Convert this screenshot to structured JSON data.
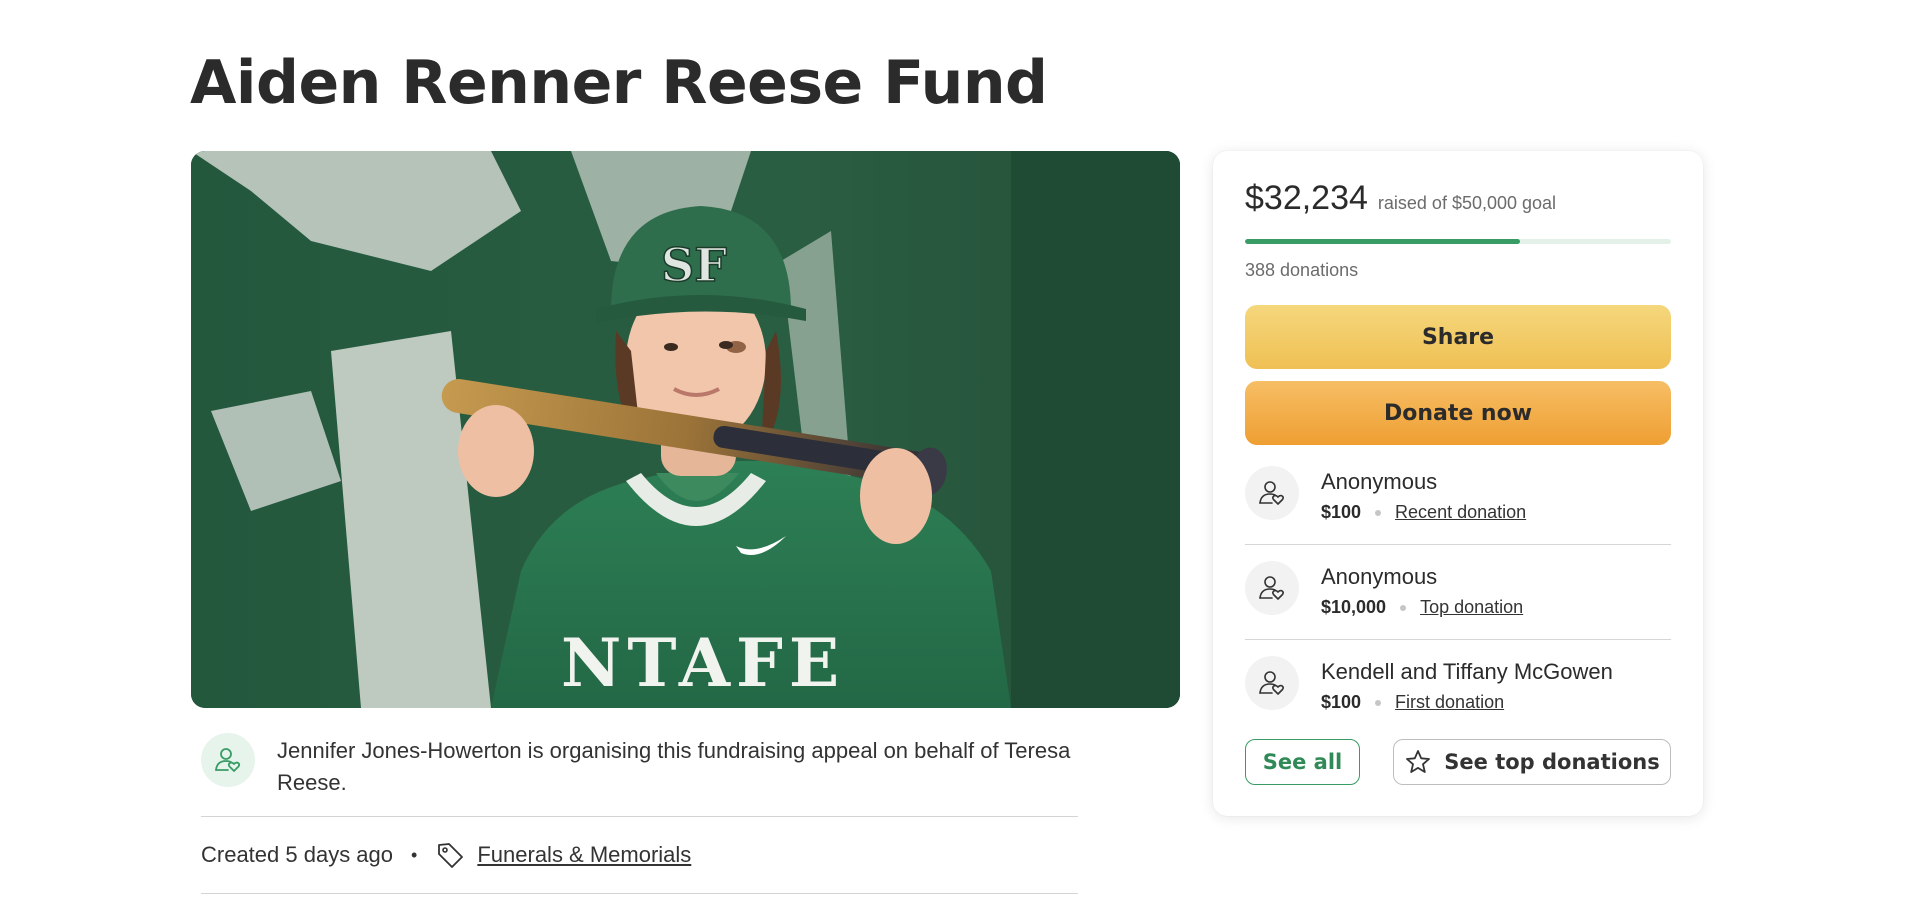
{
  "page": {
    "title": "Aiden Renner Reese Fund"
  },
  "hero_image": {
    "jersey_text": "NTAFE",
    "cap_logo": "SF"
  },
  "organiser": {
    "icon": "user-heart-icon",
    "text": "Jennifer Jones-Howerton is organising this fundraising appeal on behalf of Teresa Reese."
  },
  "meta": {
    "created": "Created 5 days ago",
    "separator": "•",
    "tag_icon": "tag-icon",
    "category": "Funerals & Memorials"
  },
  "donation_card": {
    "amount_raised": "$32,234",
    "goal_text": "raised of $50,000 goal",
    "progress_fraction": 0.645,
    "donation_count": "388 donations",
    "share_label": "Share",
    "donate_label": "Donate now",
    "donors": [
      {
        "name": "Anonymous",
        "amount": "$100",
        "label": "Recent donation"
      },
      {
        "name": "Anonymous",
        "amount": "$10,000",
        "label": "Top donation"
      },
      {
        "name": "Kendell and Tiffany McGowen",
        "amount": "$100",
        "label": "First donation"
      }
    ],
    "see_all_label": "See all",
    "see_top_label": "See top donations"
  },
  "colors": {
    "accent_green": "#3a9c65",
    "share_yellow": "#f2c862",
    "donate_orange": "#f0a842",
    "progress_track": "#e4f1e8"
  }
}
